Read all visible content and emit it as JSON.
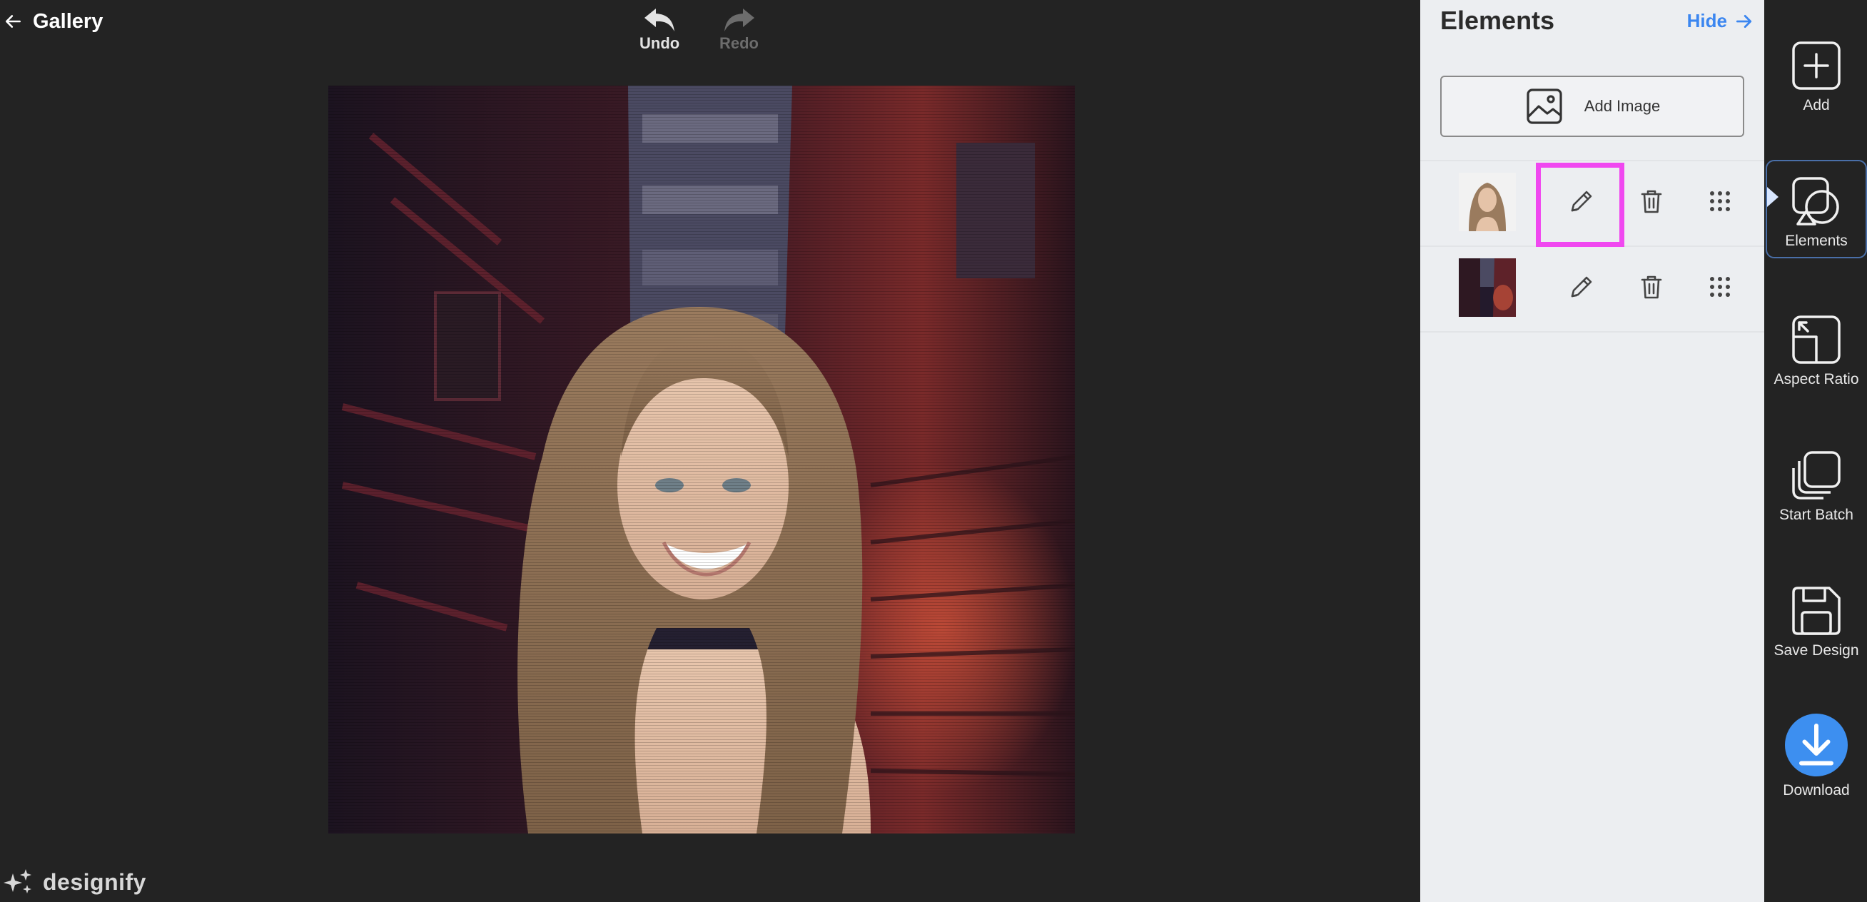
{
  "topbar": {
    "back_label": "Gallery",
    "undo_label": "Undo",
    "redo_label": "Redo"
  },
  "brand": {
    "name": "designify"
  },
  "panel": {
    "title": "Elements",
    "hide_label": "Hide",
    "add_image_label": "Add Image",
    "layers": [
      {
        "thumb": "portrait-thumbnail"
      },
      {
        "thumb": "alley-background-thumbnail"
      }
    ]
  },
  "toolbar": {
    "add": "Add",
    "elements": "Elements",
    "aspect_ratio": "Aspect Ratio",
    "start_batch": "Start Batch",
    "save_design": "Save Design",
    "download": "Download"
  },
  "colors": {
    "background": "#232323",
    "panel": "#eceef1",
    "accent": "#3b86f0",
    "highlight": "#f048f0"
  }
}
